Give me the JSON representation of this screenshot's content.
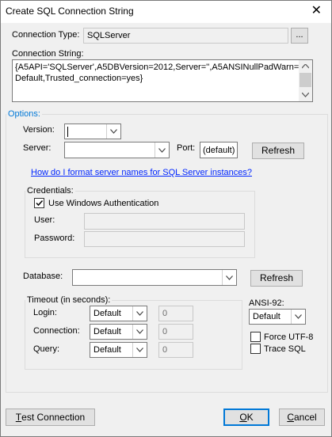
{
  "window": {
    "title": "Create SQL Connection String",
    "close": "✕"
  },
  "connection_type": {
    "label": "Connection Type:",
    "value": "SQLServer",
    "browse": "..."
  },
  "connection_string": {
    "label": "Connection String:",
    "line1": "{A5API='SQLServer',A5DBVersion=2012,Server='',A5ANSINullPadWarn=",
    "line2": "Default,Trusted_connection=yes}"
  },
  "options": {
    "title": "Options:",
    "version": {
      "label": "Version:",
      "value": ""
    },
    "server": {
      "label": "Server:",
      "value": ""
    },
    "port": {
      "label": "Port:",
      "value": "(default)"
    },
    "refresh": "Refresh",
    "help_link": "How do I format server names for SQL Server instances?"
  },
  "credentials": {
    "title": "Credentials:",
    "windows_auth": {
      "label": "Use Windows Authentication",
      "checked": true
    },
    "user": {
      "label": "User:",
      "value": ""
    },
    "password": {
      "label": "Password:",
      "value": ""
    }
  },
  "database": {
    "label": "Database:",
    "value": "",
    "refresh": "Refresh"
  },
  "timeout": {
    "title": "Timeout (in seconds):",
    "login": {
      "label": "Login:",
      "mode": "Default",
      "value": "0"
    },
    "connection": {
      "label": "Connection:",
      "mode": "Default",
      "value": "0"
    },
    "query": {
      "label": "Query:",
      "mode": "Default",
      "value": "0"
    }
  },
  "ansi92": {
    "label": "ANSI-92:",
    "value": "Default"
  },
  "force_utf8": {
    "label": "Force UTF-8",
    "checked": false
  },
  "trace_sql": {
    "label": "Trace SQL",
    "checked": false
  },
  "buttons": {
    "test_connection": {
      "accel": "T",
      "rest": "est Connection"
    },
    "ok": {
      "accel": "O",
      "rest": "K"
    },
    "cancel": {
      "accel": "C",
      "rest": "ancel"
    }
  },
  "colors": {
    "link": "#0026ff",
    "default_button_border": "#0078d7",
    "window_bg": "#f0f0f0"
  }
}
